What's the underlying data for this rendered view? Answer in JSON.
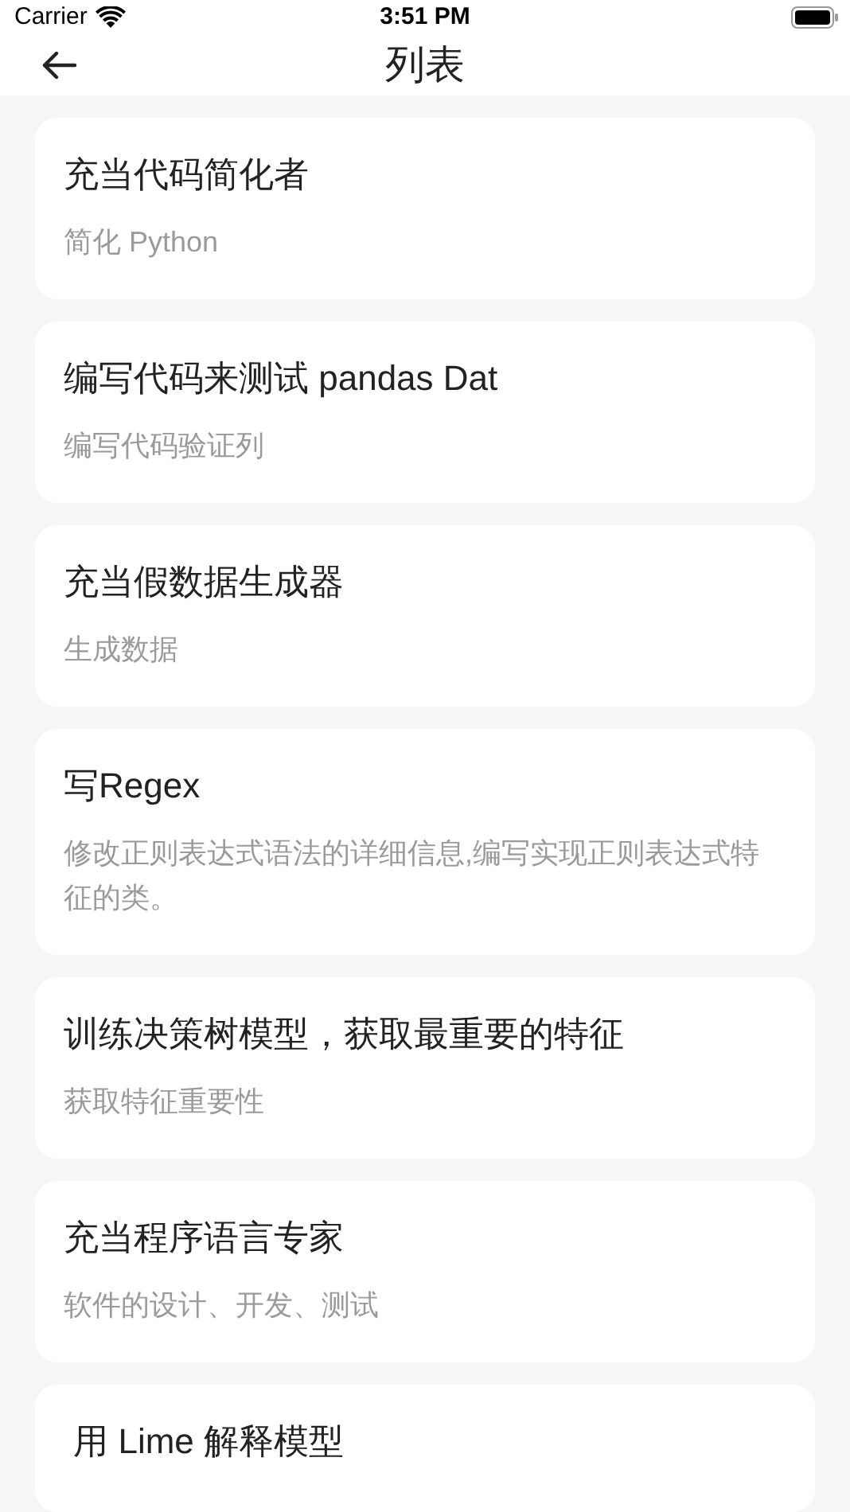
{
  "status_bar": {
    "carrier": "Carrier",
    "time": "3:51 PM"
  },
  "nav": {
    "title": "列表"
  },
  "items": [
    {
      "title": "充当代码简化者",
      "subtitle": "简化 Python"
    },
    {
      "title": "编写代码来测试 pandas Dat",
      "subtitle": "编写代码验证列"
    },
    {
      "title": "充当假数据生成器",
      "subtitle": "生成数据"
    },
    {
      "title": "写Regex",
      "subtitle": "修改正则表达式语法的详细信息,编写实现正则表达式特征的类。"
    },
    {
      "title": "训练决策树模型，获取最重要的特征",
      "subtitle": "获取特征重要性"
    },
    {
      "title": "充当程序语言专家",
      "subtitle": "软件的设计、开发、测试"
    },
    {
      "title": " 用 Lime 解释模型"
    }
  ]
}
